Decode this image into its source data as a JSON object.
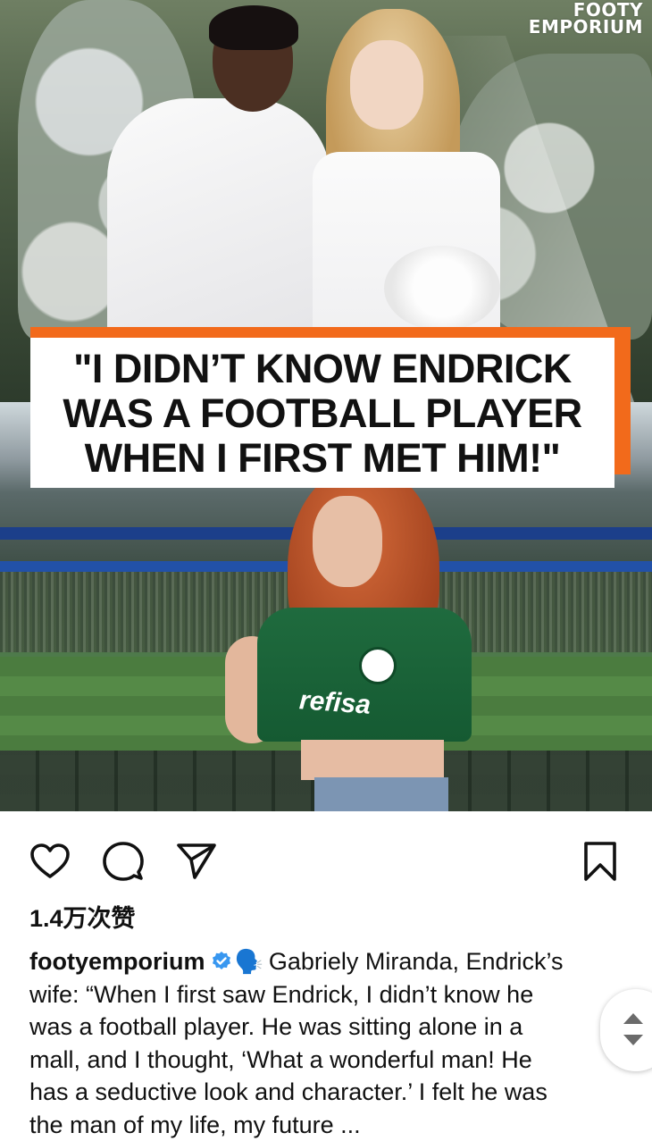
{
  "post": {
    "brand_logo": {
      "line1": "FOOTY",
      "line2": "EMPORIUM"
    },
    "headline": {
      "line1": "\"I DIDN’T KNOW ENDRICK",
      "line2": "WAS A FOOTBALL PLAYER",
      "line3": "WHEN I FIRST MET HIM!\""
    },
    "jersey_text": "refisa"
  },
  "actions": {
    "like_icon": "heart-icon",
    "comment_icon": "comment-bubble-icon",
    "share_icon": "paper-plane-icon",
    "save_icon": "bookmark-icon"
  },
  "likes": {
    "text": "1.4万次赞"
  },
  "caption": {
    "username": "footyemporium",
    "verified_icon": "verified-badge-icon",
    "emoji": "🗣️",
    "lines": [
      "Gabriely Miranda, Endrick’s",
      "wife: “When I first saw Endrick, I didn’t know he",
      "was a football player. He was sitting alone in a",
      "mall, and I thought, ‘What a wonderful man! He",
      "has a seductive look and character.’ I felt he was",
      "the man of my life, my future ..."
    ]
  },
  "colors": {
    "accent_orange": "#f26a1b",
    "verified_blue": "#3897f0",
    "jersey_green": "#1f6b3e"
  }
}
